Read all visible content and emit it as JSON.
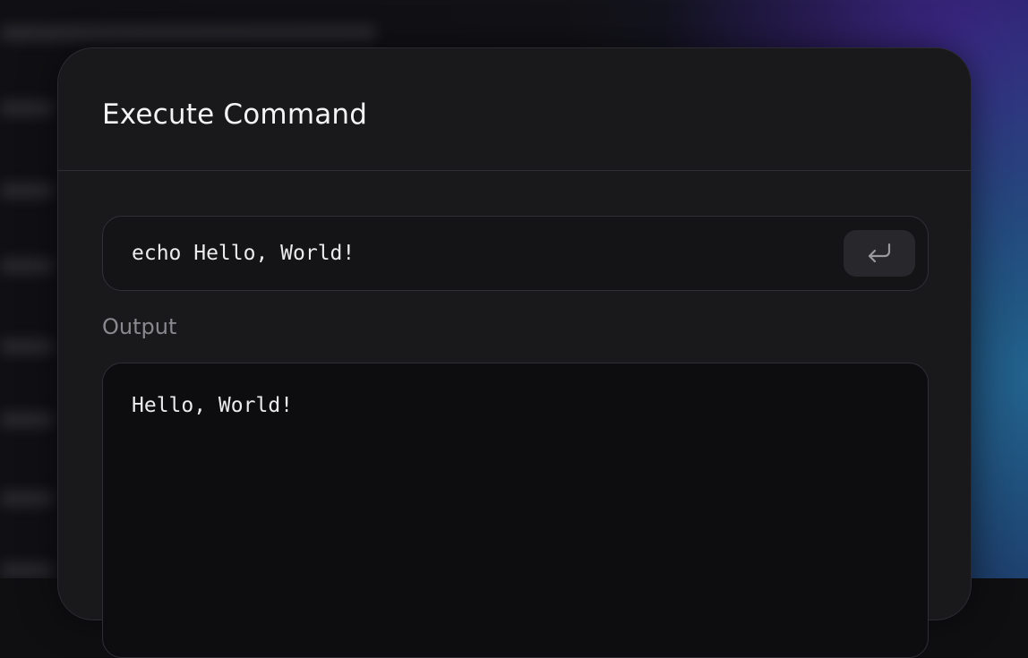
{
  "dialog": {
    "title": "Execute Command"
  },
  "command": {
    "value": "echo Hello, World!",
    "submit_icon": "return-enter-icon"
  },
  "output": {
    "label": "Output",
    "text": "Hello, World!"
  },
  "colors": {
    "dialog_bg": "#19181b",
    "input_bg": "#141316",
    "output_bg": "#0d0d10",
    "text": "#ececee",
    "muted": "#8a898f"
  }
}
